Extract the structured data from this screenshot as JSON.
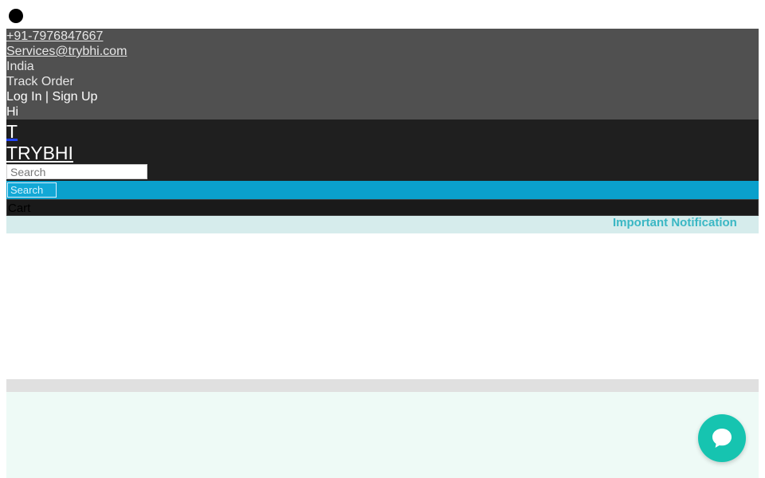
{
  "topbar": {
    "phone": "+91-7976847667",
    "email": "Services@trybhi.com",
    "country": "India",
    "track_order": "Track Order",
    "login_signup": "Log In | Sign Up",
    "greeting": "Hi"
  },
  "header": {
    "logo_letter": "T",
    "brand_name": "TRYBHI",
    "search_placeholder": "Search",
    "search_button": "Search",
    "cart_label": "Cart"
  },
  "notice": {
    "text": "Important Notification"
  },
  "icons": {
    "status_dot": "circle-icon",
    "chat": "chat-bubble-icon"
  },
  "colors": {
    "topbar_bg": "#505050",
    "header_bg": "#1f1f1f",
    "accent_blue": "#0aa0cc",
    "notice_text": "#3ab7c4",
    "chat_button": "#16c4b0"
  }
}
